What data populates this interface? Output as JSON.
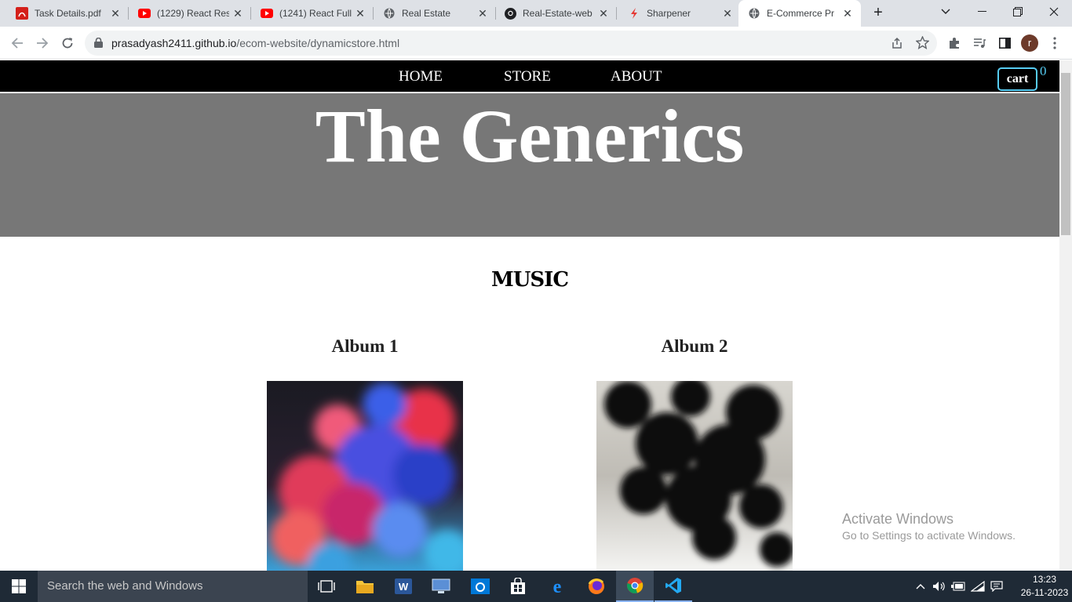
{
  "browser": {
    "tabs": [
      {
        "label": "Task Details.pdf",
        "icon": "pdf-icon",
        "active": false
      },
      {
        "label": "(1229) React Res",
        "icon": "youtube-icon",
        "active": false
      },
      {
        "label": "(1241) React Full",
        "icon": "youtube-icon",
        "active": false
      },
      {
        "label": "Real Estate",
        "icon": "globe-icon",
        "active": false
      },
      {
        "label": "Real-Estate-web",
        "icon": "github-icon",
        "active": false
      },
      {
        "label": "Sharpener",
        "icon": "sharpener-icon",
        "active": false
      },
      {
        "label": "E-Commerce Pr",
        "icon": "globe-icon",
        "active": true
      }
    ],
    "url_host": "prasadyash2411.github.io",
    "url_path": "/ecom-website/dynamicstore.html",
    "profile_initial": "r"
  },
  "site": {
    "nav": {
      "home": "HOME",
      "store": "STORE",
      "about": "ABOUT"
    },
    "cart_label": "cart",
    "cart_count": "0",
    "hero_title": "The Generics",
    "section_title": "MUSIC",
    "albums": [
      {
        "title": "Album 1"
      },
      {
        "title": "Album 2"
      }
    ]
  },
  "watermark": {
    "line1": "Activate Windows",
    "line2": "Go to Settings to activate Windows."
  },
  "taskbar": {
    "search_placeholder": "Search the web and Windows",
    "time": "13:23",
    "date": "26-11-2023"
  },
  "colors": {
    "hero_bg": "#777777",
    "cart_accent": "#56ccf2",
    "taskbar_bg": "#1f2a36"
  }
}
